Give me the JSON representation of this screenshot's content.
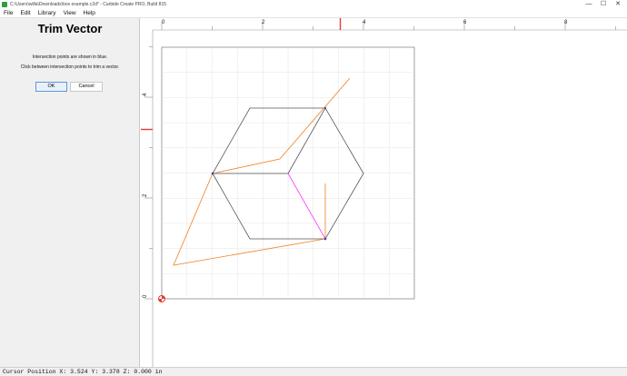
{
  "window": {
    "title": "C:\\Users\\willa\\Downloads\\box example.c2d* - Carbide Create PRO, Build 815",
    "controls": [
      "—",
      "☐",
      "✕"
    ]
  },
  "menu": [
    "File",
    "Edit",
    "Library",
    "View",
    "Help"
  ],
  "panel": {
    "title": "Trim Vector",
    "help_line1": "Intersection points are shown in blue.",
    "help_line2": "Click between intersection points to trim a vector.",
    "ok_label": "OK",
    "cancel_label": "Cancel"
  },
  "rulers": {
    "top_labels": [
      "0",
      "2",
      "4",
      "6",
      "8"
    ],
    "left_labels": [
      "4",
      "2",
      "0"
    ],
    "marker_color": "#e53935"
  },
  "status": {
    "cursor_position": "Cursor Position X: 3.524 Y: 3.378 Z: 0.000 in"
  },
  "colors": {
    "vector_gray": "#555555",
    "vector_orange": "#f07f1e",
    "selected_magenta": "#ff44ff",
    "intersection_blue": "#3344aa"
  },
  "icons": {
    "origin": "origin-icon"
  }
}
